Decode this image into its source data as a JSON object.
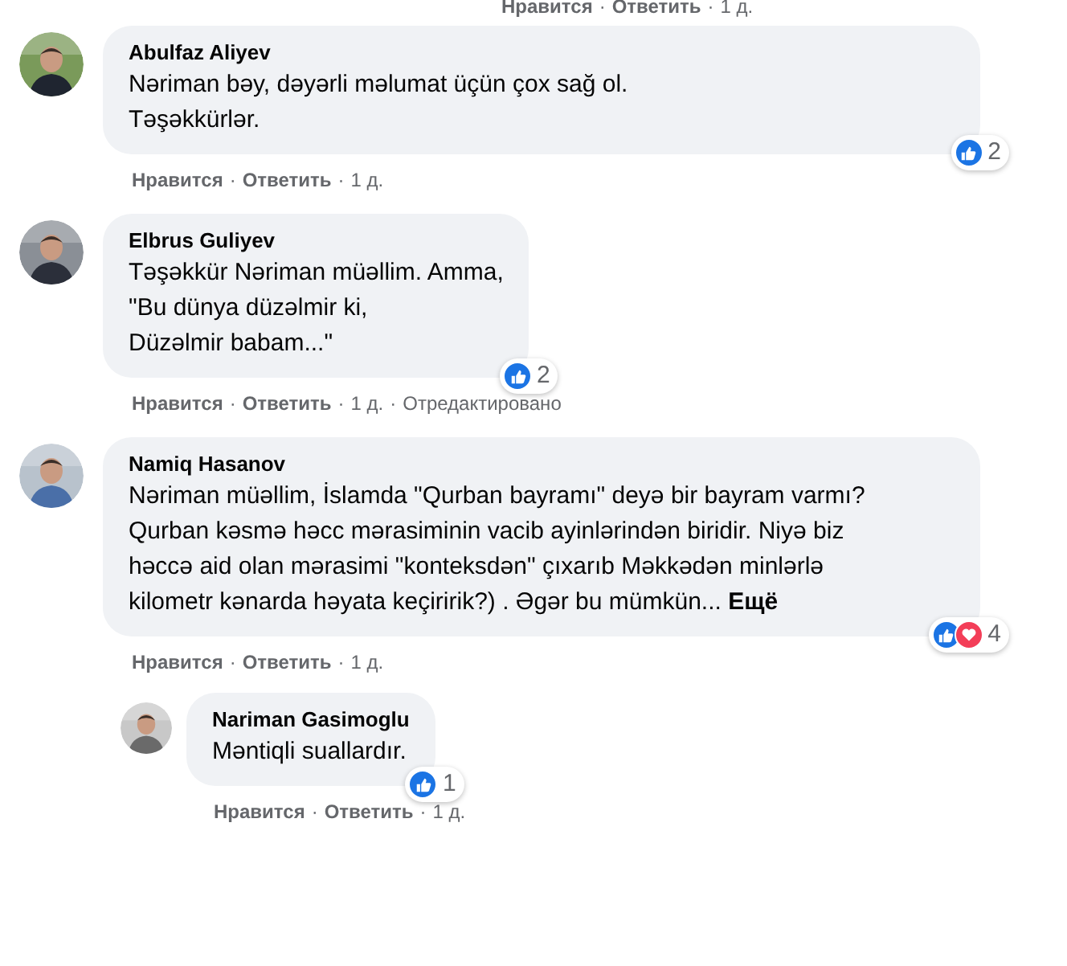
{
  "separator": "·",
  "top_actions": {
    "like": "Нравится",
    "reply": "Ответить",
    "time": "1 д."
  },
  "comments": [
    {
      "author": "Abulfaz Aliyev",
      "text": "Nəriman bəy, dəyərli məlumat üçün çox sağ ol.\nTəşəkkürlər.",
      "reactions": [
        {
          "kind": "like"
        }
      ],
      "reaction_count": "2",
      "actions": {
        "like": "Нравится",
        "reply": "Ответить",
        "time": "1 д."
      }
    },
    {
      "author": "Elbrus Guliyev",
      "text": "Təşəkkür Nəriman müəllim. Amma,\n\"Bu dünya düzəlmir ki,\nDüzəlmir babam...\"",
      "reactions": [
        {
          "kind": "like"
        }
      ],
      "reaction_count": "2",
      "actions": {
        "like": "Нравится",
        "reply": "Ответить",
        "time": "1 д.",
        "edited": "Отредактировано"
      }
    },
    {
      "author": "Namiq Hasanov",
      "text": "Nəriman müəllim, İslamda \"Qurban bayramı\" deyə bir bayram varmı?\nQurban kəsmə həcc mərasiminin vacib ayinlərindən biridir. Niyə biz həccə aid olan mərasimi \"konteksdən\" çıxarıb Məkkədən minlərlə kilometr kənarda həyata keçiririk?) . Əgər bu mümkün...",
      "more": "Ещё",
      "reactions": [
        {
          "kind": "like"
        },
        {
          "kind": "love"
        }
      ],
      "reaction_count": "4",
      "actions": {
        "like": "Нравится",
        "reply": "Ответить",
        "time": "1 д."
      },
      "replies": [
        {
          "author": "Nariman Gasimoglu",
          "text": "Məntiqli suallardır.",
          "reactions": [
            {
              "kind": "like"
            }
          ],
          "reaction_count": "1",
          "actions": {
            "like": "Нравится",
            "reply": "Ответить",
            "time": "1 д."
          }
        }
      ]
    }
  ]
}
